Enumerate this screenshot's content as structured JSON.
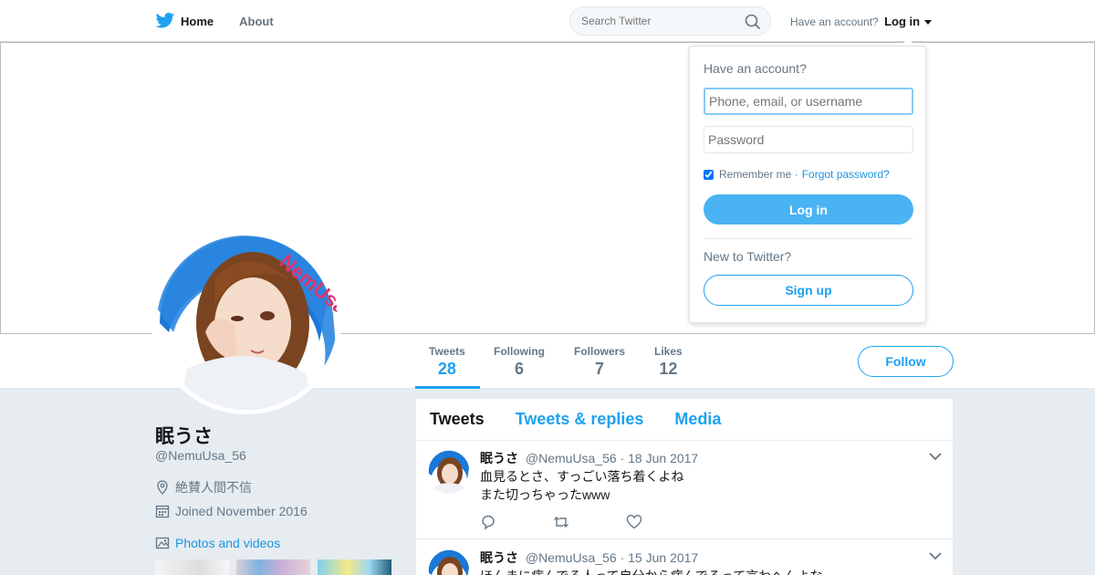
{
  "nav": {
    "home": "Home",
    "about": "About",
    "search_placeholder": "Search Twitter",
    "have_account": "Have an account?",
    "login": "Log in"
  },
  "stats": [
    {
      "label": "Tweets",
      "value": "28"
    },
    {
      "label": "Following",
      "value": "6"
    },
    {
      "label": "Followers",
      "value": "7"
    },
    {
      "label": "Likes",
      "value": "12"
    }
  ],
  "follow_label": "Follow",
  "profile": {
    "name": "眠うさ",
    "handle": "@NemuUsa_56",
    "location": "絶賛人間不信",
    "joined": "Joined November 2016",
    "photos": "Photos and videos"
  },
  "timeline": {
    "tabs": [
      "Tweets",
      "Tweets & replies",
      "Media"
    ],
    "tweets": [
      {
        "name": "眠うさ",
        "handle": "@NemuUsa_56",
        "date": "· 18 Jun 2017",
        "lines": [
          "血見るとさ、すっごい落ち着くよね",
          "また切っちゃったwww"
        ]
      },
      {
        "name": "眠うさ",
        "handle": "@NemuUsa_56",
        "date": "· 15 Jun 2017",
        "lines": [
          "ほんまに病んでる人って自分から病んでるって言わへんよな",
          ""
        ]
      }
    ]
  },
  "login_box": {
    "title": "Have an account?",
    "username_placeholder": "Phone, email, or username",
    "password_placeholder": "Password",
    "remember": "Remember me ·",
    "forgot": "Forgot password?",
    "login_button": "Log in",
    "new_to_twitter": "New to Twitter?",
    "signup_button": "Sign up"
  },
  "colors": {
    "accent": "#1da1f2",
    "background": "#e6ecf0"
  },
  "icons": [
    "twitter-bird-icon",
    "search-icon",
    "location-icon",
    "calendar-icon",
    "image-icon",
    "reply-icon",
    "retweet-icon",
    "like-icon",
    "chevron-down-icon"
  ]
}
